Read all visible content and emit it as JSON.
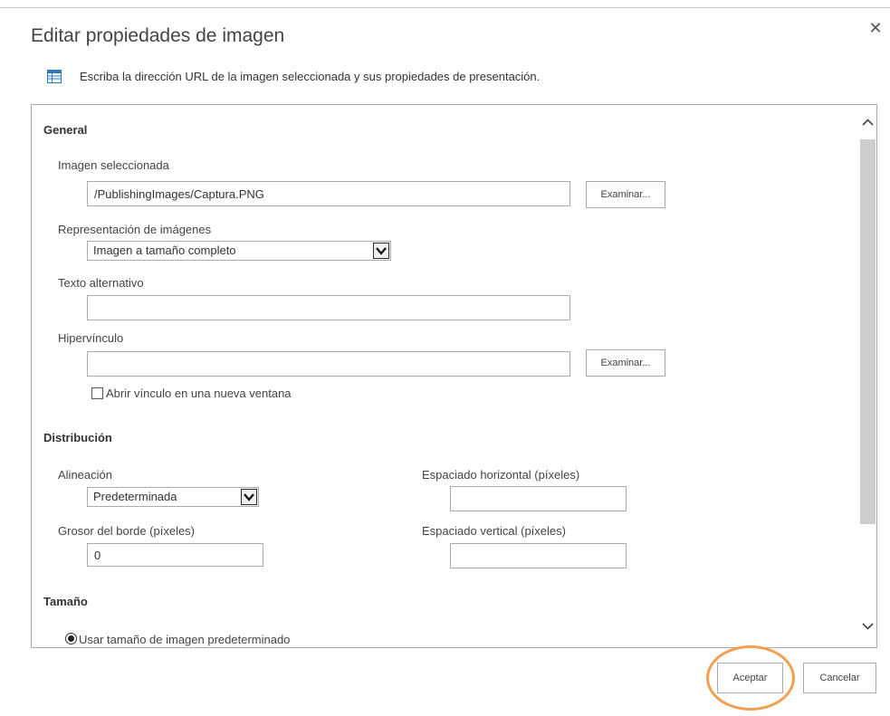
{
  "dialog": {
    "title": "Editar propiedades de imagen",
    "description": "Escriba la dirección URL de la imagen seleccionada y sus propiedades de presentación.",
    "close_icon": "close-icon",
    "description_icon": "table-icon"
  },
  "general": {
    "heading": "General",
    "selected_image": {
      "label": "Imagen seleccionada",
      "value": "/PublishingImages/Captura.PNG",
      "browse_label": "Examinar..."
    },
    "rendition": {
      "label": "Representación de imágenes",
      "selected": "Imagen a tamaño completo"
    },
    "alt_text": {
      "label": "Texto alternativo",
      "value": ""
    },
    "hyperlink": {
      "label": "Hipervínculo",
      "value": "",
      "browse_label": "Examinar...",
      "new_window_label": "Abrir vínculo en una nueva ventana",
      "new_window_checked": false
    }
  },
  "layout": {
    "heading": "Distribución",
    "alignment": {
      "label": "Alineación",
      "selected": "Predeterminada"
    },
    "border_thickness": {
      "label": "Grosor del borde (píxeles)",
      "value": "0"
    },
    "horizontal_spacing": {
      "label": "Espaciado horizontal (píxeles)",
      "value": ""
    },
    "vertical_spacing": {
      "label": "Espaciado vertical (píxeles)",
      "value": ""
    }
  },
  "size": {
    "heading": "Tamaño",
    "default_size_label": "Usar tamaño de imagen predeterminado",
    "default_size_selected": true
  },
  "footer": {
    "ok_label": "Aceptar",
    "cancel_label": "Cancelar"
  },
  "colors": {
    "highlight_ring": "#f0a050",
    "border": "#ababab",
    "scroll_thumb": "#cdcdcd"
  }
}
